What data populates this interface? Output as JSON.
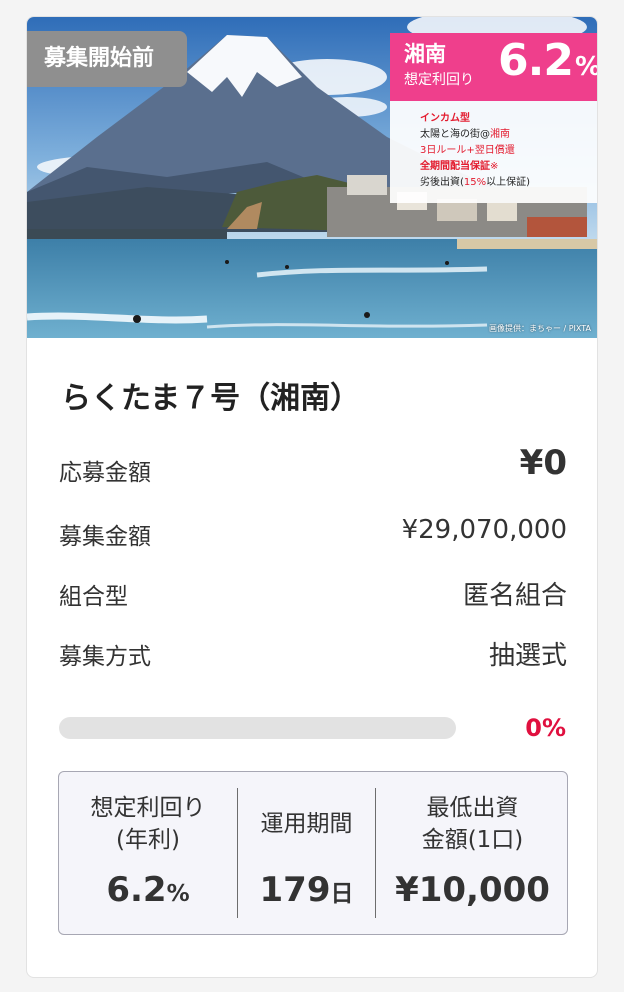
{
  "card": {
    "status_tag": "募集開始前",
    "yield_banner": {
      "region": "湘南",
      "label": "想定利回り",
      "value": "6.2",
      "unit": "%"
    },
    "features": {
      "type": "インカム型",
      "line1_a": "太陽と海の街@",
      "line1_b": "湘南",
      "line2": "3日ルール+翌日償還",
      "line3_a": "全期間配当保証",
      "line3_b": "※",
      "line4_a": "劣後出資(",
      "line4_b": "15%",
      "line4_c": "以上保証)"
    },
    "image_credit": "画像提供：まちゃー / PIXTA",
    "title": "らくたま７号（湘南）",
    "details": [
      {
        "label": "応募金額",
        "value": "¥0"
      },
      {
        "label": "募集金額",
        "value": "¥29,070,000"
      },
      {
        "label": "組合型",
        "value": "匿名組合"
      },
      {
        "label": "募集方式",
        "value": "抽選式"
      }
    ],
    "progress": {
      "percent": 0,
      "label": "0%"
    },
    "stats": {
      "yield_label_1": "想定利回り",
      "yield_label_2": "(年利)",
      "yield_value": "6.2",
      "yield_unit": "%",
      "period_label": "運用期間",
      "period_value": "179",
      "period_unit": "日",
      "min_label_1": "最低出資",
      "min_label_2": "金額(1口)",
      "min_value": "¥10,000"
    },
    "colors": {
      "accent_pink": "#ef3f8c",
      "accent_red": "#e0103f",
      "tag_gray": "#8f8f8f"
    }
  }
}
